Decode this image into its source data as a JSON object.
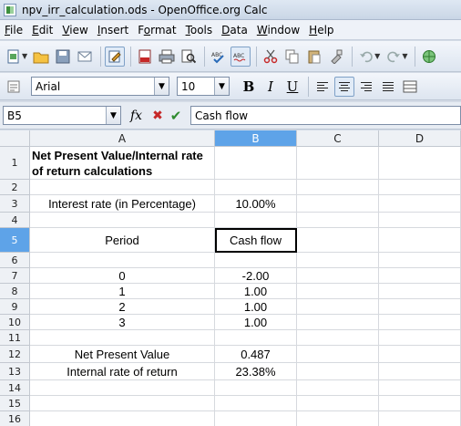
{
  "window": {
    "title": "npv_irr_calculation.ods - OpenOffice.org Calc"
  },
  "menu": [
    {
      "label": "File",
      "u": "F",
      "rest": "ile"
    },
    {
      "label": "Edit",
      "u": "E",
      "rest": "dit"
    },
    {
      "label": "View",
      "u": "V",
      "rest": "iew"
    },
    {
      "label": "Insert",
      "u": "I",
      "rest": "nsert"
    },
    {
      "label": "Format",
      "pre": "F",
      "u": "o",
      "rest": "rmat"
    },
    {
      "label": "Tools",
      "u": "T",
      "rest": "ools"
    },
    {
      "label": "Data",
      "u": "D",
      "rest": "ata"
    },
    {
      "label": "Window",
      "u": "W",
      "rest": "indow"
    },
    {
      "label": "Help",
      "u": "H",
      "rest": "elp"
    }
  ],
  "format_toolbar": {
    "font_name": "Arial",
    "font_size": "10",
    "bold": "B",
    "italic": "I",
    "underline": "U"
  },
  "formula_bar": {
    "cell_ref": "B5",
    "content": "Cash flow"
  },
  "columns": [
    "A",
    "B",
    "C",
    "D"
  ],
  "selected": {
    "column": "B",
    "row": "5"
  },
  "rows": [
    {
      "num": "1",
      "A": "Net Present Value/Internal rate of return calculations",
      "B": ""
    },
    {
      "num": "2",
      "A": "",
      "B": ""
    },
    {
      "num": "3",
      "A": "Interest rate (in Percentage)",
      "B": "10.00%"
    },
    {
      "num": "4",
      "A": "",
      "B": ""
    },
    {
      "num": "5",
      "A": "Period",
      "B": "Cash flow"
    },
    {
      "num": "6",
      "A": "",
      "B": ""
    },
    {
      "num": "7",
      "A": "0",
      "B": "-2.00"
    },
    {
      "num": "8",
      "A": "1",
      "B": "1.00"
    },
    {
      "num": "9",
      "A": "2",
      "B": "1.00"
    },
    {
      "num": "10",
      "A": "3",
      "B": "1.00"
    },
    {
      "num": "11",
      "A": "",
      "B": ""
    },
    {
      "num": "12",
      "A": "Net Present Value",
      "B": "0.487"
    },
    {
      "num": "13",
      "A": "Internal rate of return",
      "B": "23.38%"
    },
    {
      "num": "14",
      "A": "",
      "B": ""
    },
    {
      "num": "15",
      "A": "",
      "B": ""
    },
    {
      "num": "16",
      "A": "",
      "B": ""
    }
  ]
}
